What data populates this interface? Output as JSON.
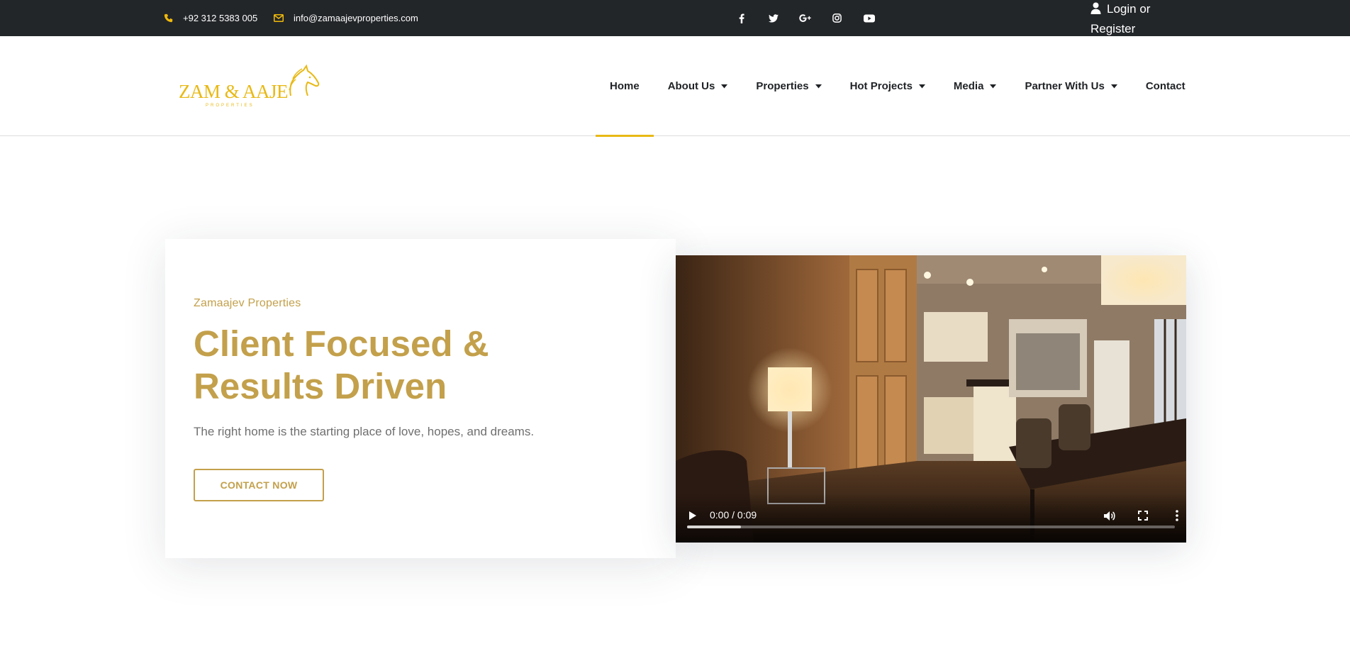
{
  "topbar": {
    "phone": "+92 312 5383 005",
    "email": "info@zamaajevproperties.com",
    "social": [
      "facebook-icon",
      "twitter-icon",
      "google-plus-icon",
      "instagram-icon",
      "youtube-icon"
    ],
    "login_line1": "Login or",
    "login_line2": "Register"
  },
  "header": {
    "logo_text": "ZAM & AAJEV",
    "logo_subtext": "PROPERTIES",
    "nav": [
      {
        "label": "Home",
        "dropdown": false,
        "active": true
      },
      {
        "label": "About Us",
        "dropdown": true
      },
      {
        "label": "Properties",
        "dropdown": true
      },
      {
        "label": "Hot Projects",
        "dropdown": true
      },
      {
        "label": "Media",
        "dropdown": true
      },
      {
        "label": "Partner With Us",
        "dropdown": true
      },
      {
        "label": "Contact",
        "dropdown": false
      }
    ]
  },
  "hero": {
    "eyebrow": "Zamaajev Properties",
    "headline_line1": "Client Focused &",
    "headline_line2": "Results Driven",
    "subtext": "The right home is the starting place of love, hopes, and dreams.",
    "cta": "CONTACT NOW"
  },
  "video": {
    "time": "0:00 / 0:09",
    "buffered_fraction": 0.11
  },
  "colors": {
    "accent": "#c3a04b",
    "nav_active": "#e8b914",
    "topbar_bg": "#232629",
    "icon_yellow": "#f0b90b"
  }
}
